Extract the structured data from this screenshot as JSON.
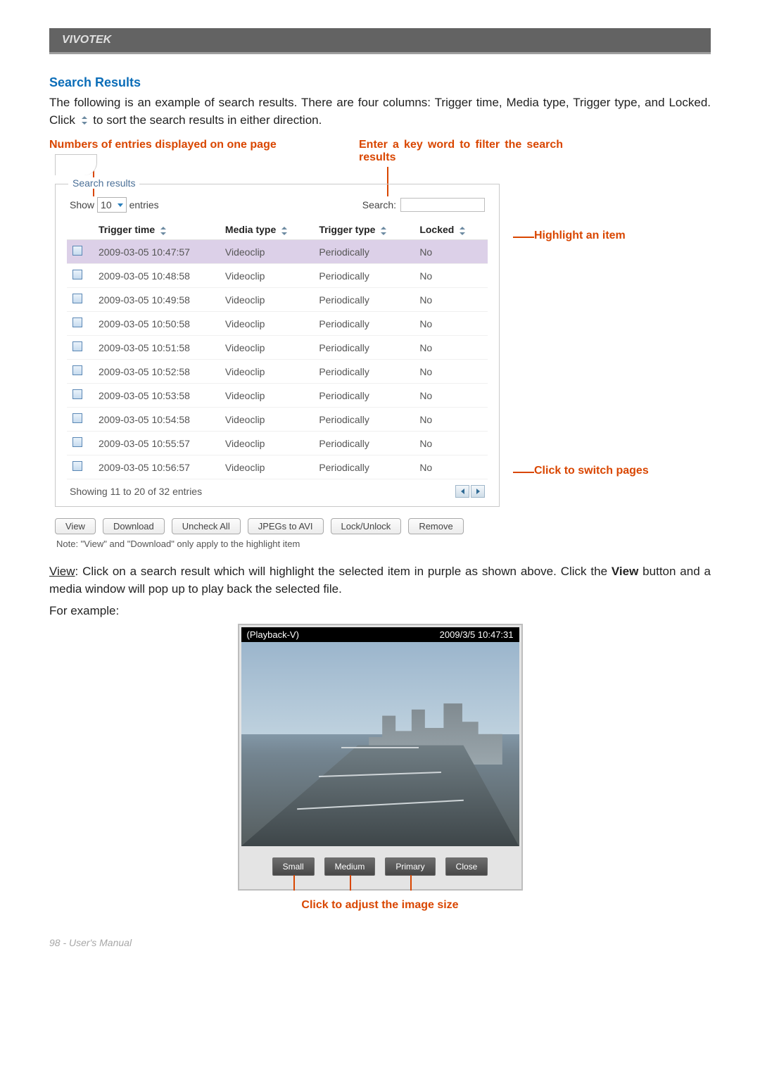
{
  "header": {
    "brand": "VIVOTEK"
  },
  "section": {
    "title": "Search Results",
    "intro_before": "The following is an example of search results. There are four columns: Trigger time, Media type, Trigger type, and Locked. Click ",
    "intro_after": " to sort the search results in either direction."
  },
  "annotations": {
    "entries": "Numbers of entries displayed on one page",
    "search_filter": "Enter a key word to filter the search results",
    "highlight": "Highlight an item",
    "switch_pages": "Click to switch pages",
    "adjust_size": "Click to adjust the image size"
  },
  "panel": {
    "legend": "Search results",
    "show_label": "Show",
    "entries_value": "10",
    "entries_suffix": "entries",
    "search_label": "Search:",
    "search_value": "",
    "columns": {
      "trigger_time": "Trigger time",
      "media_type": "Media type",
      "trigger_type": "Trigger type",
      "locked": "Locked"
    },
    "rows": [
      {
        "trigger_time": "2009-03-05 10:47:57",
        "media_type": "Videoclip",
        "trigger_type": "Periodically",
        "locked": "No",
        "highlighted": true
      },
      {
        "trigger_time": "2009-03-05 10:48:58",
        "media_type": "Videoclip",
        "trigger_type": "Periodically",
        "locked": "No",
        "highlighted": false
      },
      {
        "trigger_time": "2009-03-05 10:49:58",
        "media_type": "Videoclip",
        "trigger_type": "Periodically",
        "locked": "No",
        "highlighted": false
      },
      {
        "trigger_time": "2009-03-05 10:50:58",
        "media_type": "Videoclip",
        "trigger_type": "Periodically",
        "locked": "No",
        "highlighted": false
      },
      {
        "trigger_time": "2009-03-05 10:51:58",
        "media_type": "Videoclip",
        "trigger_type": "Periodically",
        "locked": "No",
        "highlighted": false
      },
      {
        "trigger_time": "2009-03-05 10:52:58",
        "media_type": "Videoclip",
        "trigger_type": "Periodically",
        "locked": "No",
        "highlighted": false
      },
      {
        "trigger_time": "2009-03-05 10:53:58",
        "media_type": "Videoclip",
        "trigger_type": "Periodically",
        "locked": "No",
        "highlighted": false
      },
      {
        "trigger_time": "2009-03-05 10:54:58",
        "media_type": "Videoclip",
        "trigger_type": "Periodically",
        "locked": "No",
        "highlighted": false
      },
      {
        "trigger_time": "2009-03-05 10:55:57",
        "media_type": "Videoclip",
        "trigger_type": "Periodically",
        "locked": "No",
        "highlighted": false
      },
      {
        "trigger_time": "2009-03-05 10:56:57",
        "media_type": "Videoclip",
        "trigger_type": "Periodically",
        "locked": "No",
        "highlighted": false
      }
    ],
    "footer_status": "Showing 11 to 20 of 32 entries"
  },
  "buttons": {
    "view": "View",
    "download": "Download",
    "uncheck_all": "Uncheck All",
    "jpegs_to_avi": "JPEGs to AVI",
    "lock_unlock": "Lock/Unlock",
    "remove": "Remove"
  },
  "note": "Note: \"View\" and \"Download\" only apply to the highlight item",
  "explain": {
    "view_label": "View",
    "view_text_a": ": Click on a search result which will highlight the selected item in purple as shown above. Click the ",
    "view_bold": "View",
    "view_text_b": " button and a media window will pop up to play back the selected file.",
    "example": "For example:"
  },
  "playback": {
    "title": "(Playback-V)",
    "timestamp": "2009/3/5 10:47:31",
    "small": "Small",
    "medium": "Medium",
    "primary": "Primary",
    "close": "Close"
  },
  "footer": {
    "text": "98 - User's Manual"
  }
}
